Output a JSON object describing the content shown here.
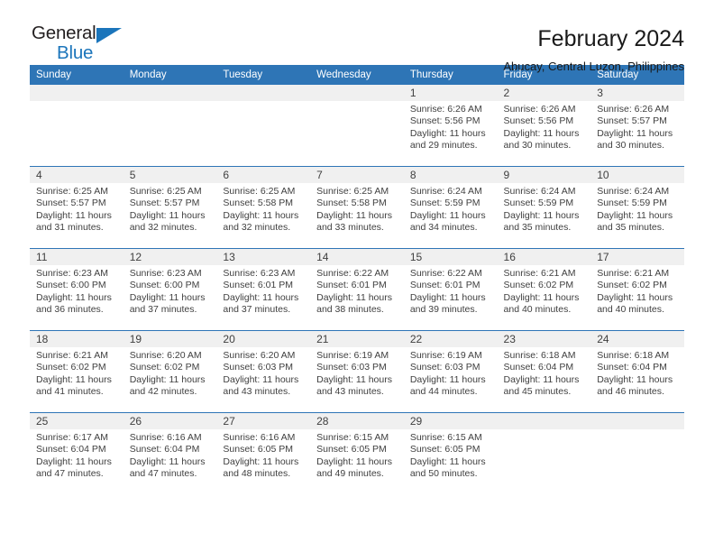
{
  "brand": {
    "name_part1": "General",
    "name_part2": "Blue",
    "accent_color": "#1b75bb"
  },
  "header": {
    "title": "February 2024",
    "subtitle": "Abucay, Central Luzon, Philippines"
  },
  "theme": {
    "header_bg": "#2e75b6",
    "daynum_bg": "#f0f0f0",
    "text_color": "#404040"
  },
  "calendar": {
    "weekday_headers": [
      "Sunday",
      "Monday",
      "Tuesday",
      "Wednesday",
      "Thursday",
      "Friday",
      "Saturday"
    ],
    "labels": {
      "sunrise": "Sunrise:",
      "sunset": "Sunset:",
      "daylight": "Daylight:"
    },
    "weeks": [
      [
        {
          "day": "",
          "empty": true
        },
        {
          "day": "",
          "empty": true
        },
        {
          "day": "",
          "empty": true
        },
        {
          "day": "",
          "empty": true
        },
        {
          "day": "1",
          "sunrise": "Sunrise: 6:26 AM",
          "sunset": "Sunset: 5:56 PM",
          "daylight": "Daylight: 11 hours and 29 minutes."
        },
        {
          "day": "2",
          "sunrise": "Sunrise: 6:26 AM",
          "sunset": "Sunset: 5:56 PM",
          "daylight": "Daylight: 11 hours and 30 minutes."
        },
        {
          "day": "3",
          "sunrise": "Sunrise: 6:26 AM",
          "sunset": "Sunset: 5:57 PM",
          "daylight": "Daylight: 11 hours and 30 minutes."
        }
      ],
      [
        {
          "day": "4",
          "sunrise": "Sunrise: 6:25 AM",
          "sunset": "Sunset: 5:57 PM",
          "daylight": "Daylight: 11 hours and 31 minutes."
        },
        {
          "day": "5",
          "sunrise": "Sunrise: 6:25 AM",
          "sunset": "Sunset: 5:57 PM",
          "daylight": "Daylight: 11 hours and 32 minutes."
        },
        {
          "day": "6",
          "sunrise": "Sunrise: 6:25 AM",
          "sunset": "Sunset: 5:58 PM",
          "daylight": "Daylight: 11 hours and 32 minutes."
        },
        {
          "day": "7",
          "sunrise": "Sunrise: 6:25 AM",
          "sunset": "Sunset: 5:58 PM",
          "daylight": "Daylight: 11 hours and 33 minutes."
        },
        {
          "day": "8",
          "sunrise": "Sunrise: 6:24 AM",
          "sunset": "Sunset: 5:59 PM",
          "daylight": "Daylight: 11 hours and 34 minutes."
        },
        {
          "day": "9",
          "sunrise": "Sunrise: 6:24 AM",
          "sunset": "Sunset: 5:59 PM",
          "daylight": "Daylight: 11 hours and 35 minutes."
        },
        {
          "day": "10",
          "sunrise": "Sunrise: 6:24 AM",
          "sunset": "Sunset: 5:59 PM",
          "daylight": "Daylight: 11 hours and 35 minutes."
        }
      ],
      [
        {
          "day": "11",
          "sunrise": "Sunrise: 6:23 AM",
          "sunset": "Sunset: 6:00 PM",
          "daylight": "Daylight: 11 hours and 36 minutes."
        },
        {
          "day": "12",
          "sunrise": "Sunrise: 6:23 AM",
          "sunset": "Sunset: 6:00 PM",
          "daylight": "Daylight: 11 hours and 37 minutes."
        },
        {
          "day": "13",
          "sunrise": "Sunrise: 6:23 AM",
          "sunset": "Sunset: 6:01 PM",
          "daylight": "Daylight: 11 hours and 37 minutes."
        },
        {
          "day": "14",
          "sunrise": "Sunrise: 6:22 AM",
          "sunset": "Sunset: 6:01 PM",
          "daylight": "Daylight: 11 hours and 38 minutes."
        },
        {
          "day": "15",
          "sunrise": "Sunrise: 6:22 AM",
          "sunset": "Sunset: 6:01 PM",
          "daylight": "Daylight: 11 hours and 39 minutes."
        },
        {
          "day": "16",
          "sunrise": "Sunrise: 6:21 AM",
          "sunset": "Sunset: 6:02 PM",
          "daylight": "Daylight: 11 hours and 40 minutes."
        },
        {
          "day": "17",
          "sunrise": "Sunrise: 6:21 AM",
          "sunset": "Sunset: 6:02 PM",
          "daylight": "Daylight: 11 hours and 40 minutes."
        }
      ],
      [
        {
          "day": "18",
          "sunrise": "Sunrise: 6:21 AM",
          "sunset": "Sunset: 6:02 PM",
          "daylight": "Daylight: 11 hours and 41 minutes."
        },
        {
          "day": "19",
          "sunrise": "Sunrise: 6:20 AM",
          "sunset": "Sunset: 6:02 PM",
          "daylight": "Daylight: 11 hours and 42 minutes."
        },
        {
          "day": "20",
          "sunrise": "Sunrise: 6:20 AM",
          "sunset": "Sunset: 6:03 PM",
          "daylight": "Daylight: 11 hours and 43 minutes."
        },
        {
          "day": "21",
          "sunrise": "Sunrise: 6:19 AM",
          "sunset": "Sunset: 6:03 PM",
          "daylight": "Daylight: 11 hours and 43 minutes."
        },
        {
          "day": "22",
          "sunrise": "Sunrise: 6:19 AM",
          "sunset": "Sunset: 6:03 PM",
          "daylight": "Daylight: 11 hours and 44 minutes."
        },
        {
          "day": "23",
          "sunrise": "Sunrise: 6:18 AM",
          "sunset": "Sunset: 6:04 PM",
          "daylight": "Daylight: 11 hours and 45 minutes."
        },
        {
          "day": "24",
          "sunrise": "Sunrise: 6:18 AM",
          "sunset": "Sunset: 6:04 PM",
          "daylight": "Daylight: 11 hours and 46 minutes."
        }
      ],
      [
        {
          "day": "25",
          "sunrise": "Sunrise: 6:17 AM",
          "sunset": "Sunset: 6:04 PM",
          "daylight": "Daylight: 11 hours and 47 minutes."
        },
        {
          "day": "26",
          "sunrise": "Sunrise: 6:16 AM",
          "sunset": "Sunset: 6:04 PM",
          "daylight": "Daylight: 11 hours and 47 minutes."
        },
        {
          "day": "27",
          "sunrise": "Sunrise: 6:16 AM",
          "sunset": "Sunset: 6:05 PM",
          "daylight": "Daylight: 11 hours and 48 minutes."
        },
        {
          "day": "28",
          "sunrise": "Sunrise: 6:15 AM",
          "sunset": "Sunset: 6:05 PM",
          "daylight": "Daylight: 11 hours and 49 minutes."
        },
        {
          "day": "29",
          "sunrise": "Sunrise: 6:15 AM",
          "sunset": "Sunset: 6:05 PM",
          "daylight": "Daylight: 11 hours and 50 minutes."
        },
        {
          "day": "",
          "empty": true
        },
        {
          "day": "",
          "empty": true
        }
      ]
    ]
  }
}
